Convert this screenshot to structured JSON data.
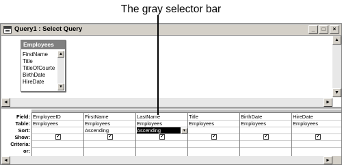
{
  "callout": {
    "text": "The gray selector bar"
  },
  "window": {
    "title": "Query1 : Select Query",
    "buttons": {
      "minimize": "_",
      "restore": "□",
      "close": "×"
    }
  },
  "field_list": {
    "title": "Employees",
    "fields": [
      "FirstName",
      "Title",
      "TitleOfCourte",
      "BirthDate",
      "HireDate"
    ]
  },
  "grid": {
    "row_labels": [
      "Field:",
      "Table:",
      "Sort:",
      "Show:",
      "Criteria:",
      "or:"
    ],
    "columns": [
      {
        "field": "EmployeeID",
        "table": "Employees",
        "sort": "",
        "show": true
      },
      {
        "field": "FirstName",
        "table": "Employees",
        "sort": "Ascending",
        "show": true
      },
      {
        "field": "LastName",
        "table": "Employees",
        "sort": "Ascending",
        "show": true
      },
      {
        "field": "Title",
        "table": "Employees",
        "sort": "",
        "show": true
      },
      {
        "field": "BirthDate",
        "table": "Employees",
        "sort": "",
        "show": true
      },
      {
        "field": "HireDate",
        "table": "Employees",
        "sort": "",
        "show": true
      }
    ]
  },
  "scroll": {
    "left": "◄",
    "right": "►",
    "up": "▲",
    "down": "▼"
  }
}
